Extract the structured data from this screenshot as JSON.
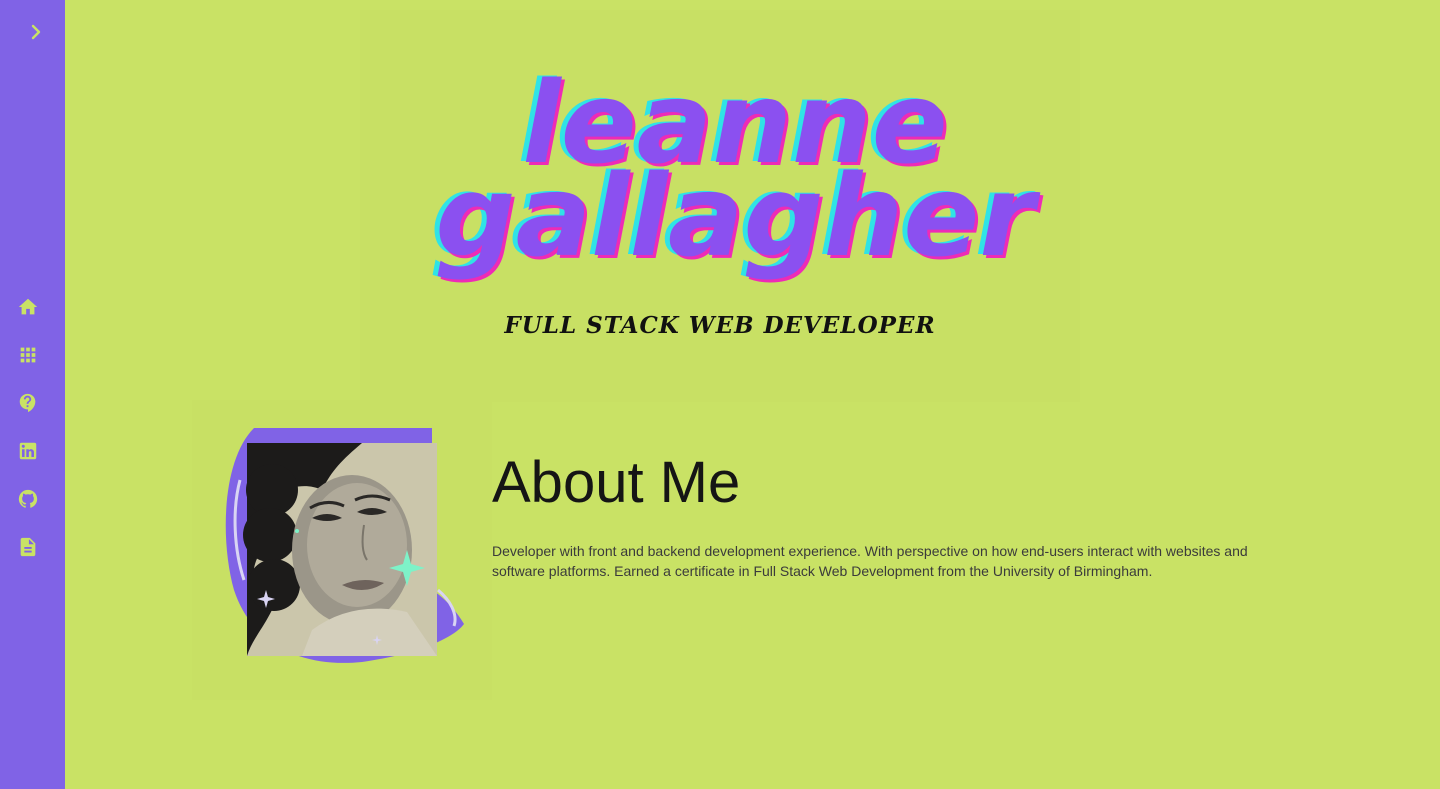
{
  "sidebar": {
    "expand_icon": "chevron-right-icon",
    "items": [
      {
        "icon": "home-icon"
      },
      {
        "icon": "apps-grid-icon"
      },
      {
        "icon": "help-icon"
      },
      {
        "icon": "linkedin-icon"
      },
      {
        "icon": "github-icon"
      },
      {
        "icon": "document-icon"
      }
    ]
  },
  "hero": {
    "name_line1": "leanne",
    "name_line2": "gallagher",
    "subtitle": "FULL STACK WEB DEVELOPER"
  },
  "about": {
    "title": "About Me",
    "text": "Developer with front and backend development experience. With perspective on how end-users interact with websites and software platforms. Earned a certificate in Full Stack Web Development from the University of Birmingham."
  },
  "colors": {
    "background": "#c9e265",
    "sidebar": "#8063e6",
    "name_fill": "#8b50f0",
    "name_shadow_cyan": "#2fe3e6",
    "name_shadow_pink": "#ee2bb6",
    "sparkle": "#7ef2c8"
  }
}
